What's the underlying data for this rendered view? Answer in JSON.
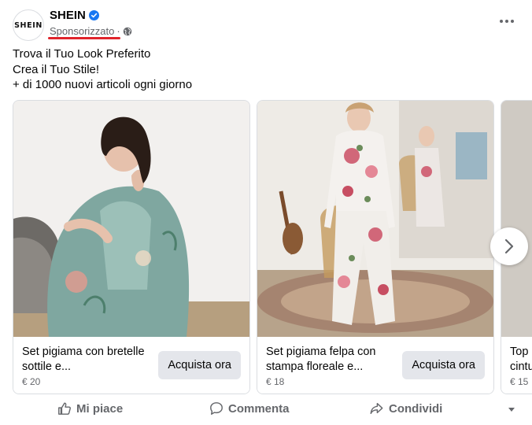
{
  "post": {
    "page_name": "SHEIN",
    "avatar_text": "SHEIN",
    "sponsored_label": "Sponsorizzato",
    "separator": "·",
    "text_lines": [
      "Trova il Tuo Look Preferito",
      "Crea il Tuo Stile!",
      "+ di 1000 nuovi articoli ogni giorno"
    ]
  },
  "cards": [
    {
      "title": "Set pigiama con bretelle sottile e...",
      "price": "€ 20",
      "cta": "Acquista ora"
    },
    {
      "title": "Set pigiama felpa con stampa floreale e...",
      "price": "€ 18",
      "cta": "Acquista ora"
    },
    {
      "title": "Top cintu",
      "price": "€ 15",
      "cta": ""
    }
  ],
  "actions": {
    "like": "Mi piace",
    "comment": "Commenta",
    "share": "Condividi"
  },
  "colors": {
    "accent_blue": "#1877f2",
    "text_secondary": "#65676b",
    "button_bg": "#e4e6eb",
    "highlight_red": "#e0242b"
  },
  "icons": [
    "verified-badge-icon",
    "globe-icon",
    "more-options-icon",
    "chevron-right-icon",
    "like-icon",
    "comment-icon",
    "share-icon",
    "audience-dropdown-icon"
  ]
}
